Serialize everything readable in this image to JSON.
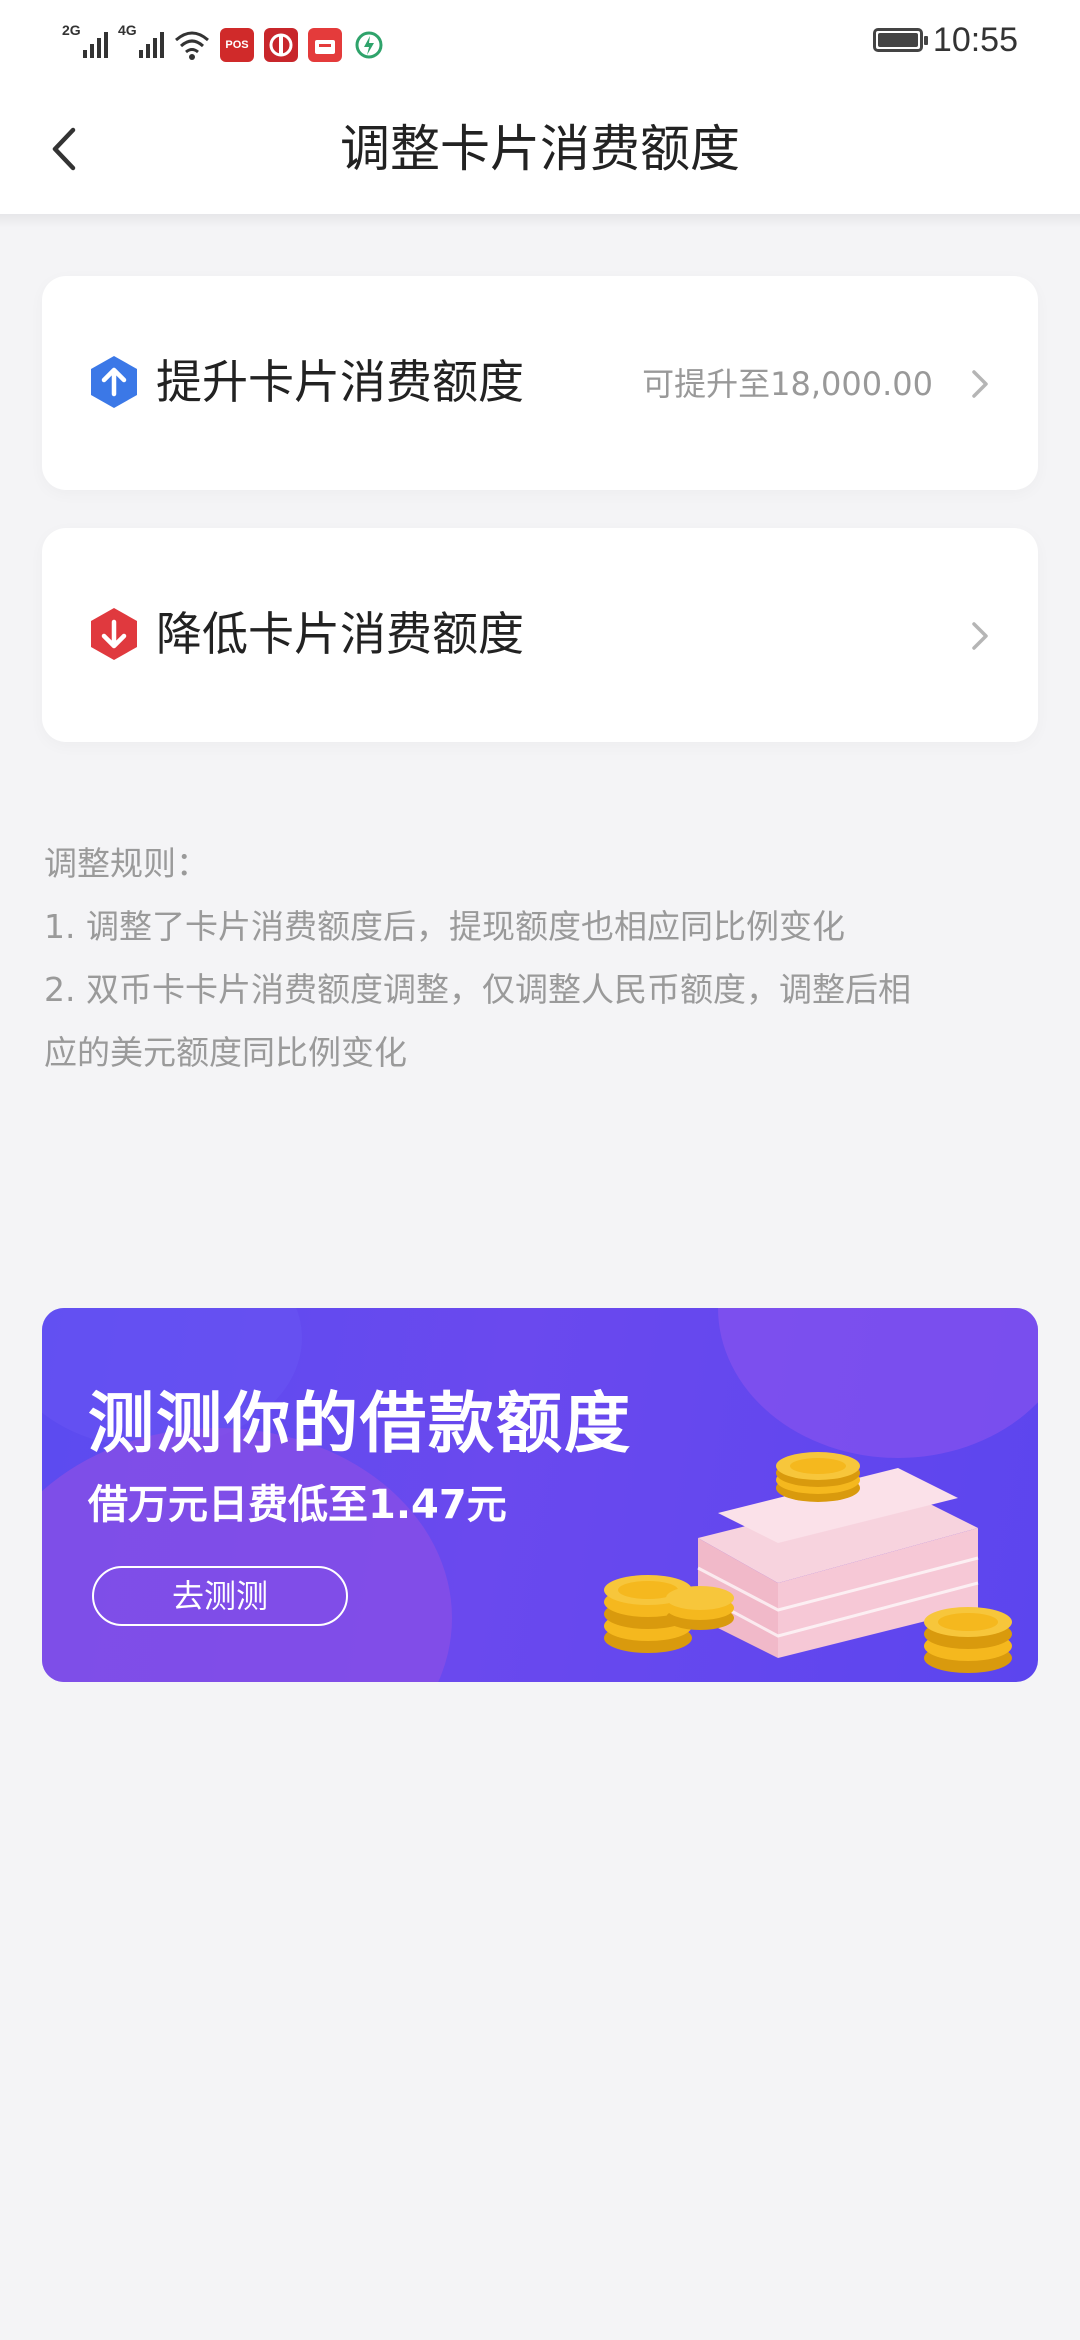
{
  "status_bar": {
    "signal_1": "2G",
    "signal_2": "4G",
    "time": "10:55",
    "icons": [
      "signal-2g-icon",
      "signal-4g-icon",
      "wifi-icon",
      "pos-app-icon",
      "citic-app-icon",
      "shop-app-icon",
      "charging-app-icon",
      "battery-icon"
    ]
  },
  "header": {
    "title": "调整卡片消费额度"
  },
  "options": [
    {
      "label": "提升卡片消费额度",
      "hint": "可提升至18,000.00",
      "icon": "raise-arrow-icon",
      "icon_color": "#3b78e7"
    },
    {
      "label": "降低卡片消费额度",
      "hint": "",
      "icon": "lower-arrow-icon",
      "icon_color": "#e0393e"
    }
  ],
  "rules": {
    "heading": "调整规则：",
    "items": [
      "1. 调整了卡片消费额度后，提现额度也相应同比例变化",
      "2. 双币卡卡片消费额度调整，仅调整人民币额度，调整后相",
      "应的美元额度同比例变化"
    ]
  },
  "banner": {
    "title": "测测你的借款额度",
    "subtitle": "借万元日费低至1.47元",
    "button": "去测测",
    "colors": {
      "background": "#5b4bf0",
      "accent": "#8a4fe6",
      "coin": "#f5b81e"
    }
  }
}
